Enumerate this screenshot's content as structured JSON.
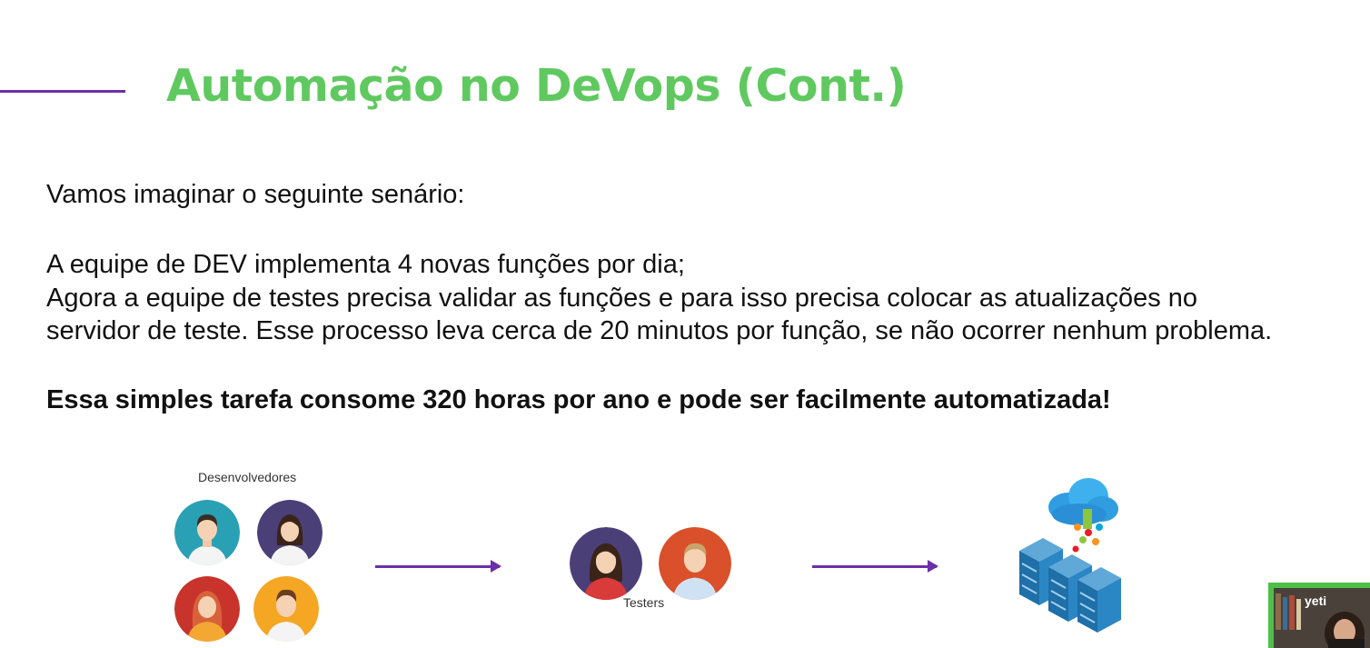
{
  "slide": {
    "title": "Automação no DeVops (Cont.)",
    "intro": "Vamos imaginar o seguinte senário:",
    "line1": "A equipe de DEV implementa 4 novas funções por dia;",
    "line2": "Agora a equipe de testes precisa validar as funções e para isso precisa colocar as atualizações no",
    "line3": "servidor de teste. Esse processo leva cerca de 20 minutos por função, se não ocorrer nenhum problema.",
    "conclusion": "Essa simples tarefa consome 320 horas por ano e pode ser facilmente automatizada!",
    "accent_color": "#6b2fa8",
    "title_color": "#5fc960"
  },
  "diagram": {
    "developers_label": "Desenvolvedores",
    "testers_label": "Testers",
    "server_icon": "cloud-server-icon"
  },
  "webcam": {
    "label": "yeti"
  }
}
